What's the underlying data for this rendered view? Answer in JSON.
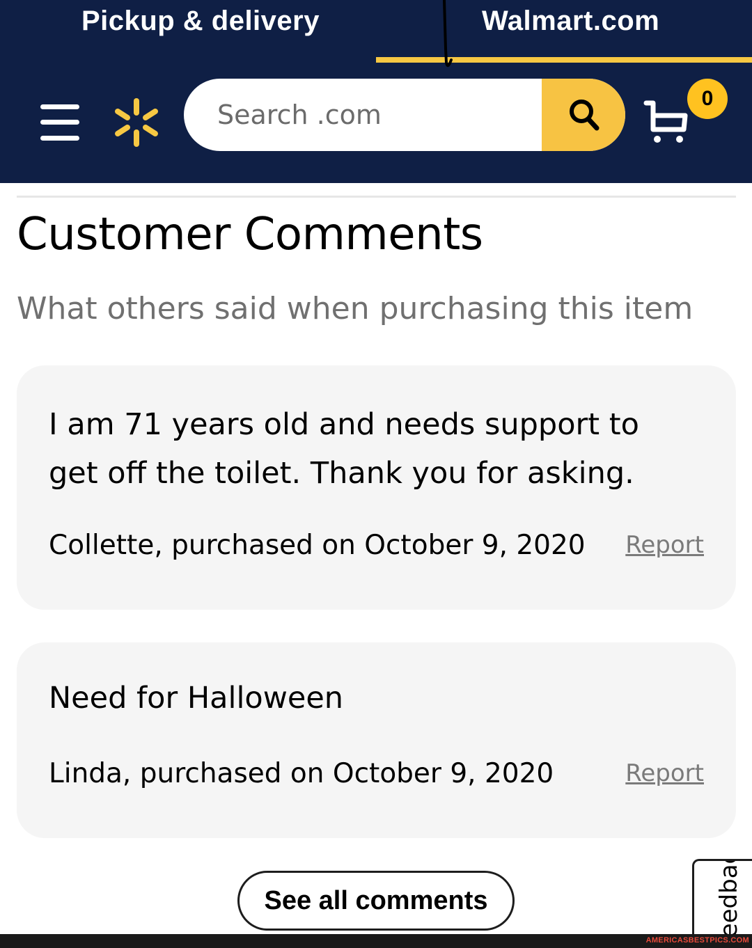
{
  "header": {
    "tabs": [
      {
        "label": "Pickup & delivery",
        "active": false
      },
      {
        "label": "Walmart.com",
        "active": true
      }
    ],
    "search": {
      "placeholder": "Search .com",
      "value": ""
    },
    "cart": {
      "count": "0"
    },
    "icons": [
      "menu-icon",
      "walmart-spark-icon",
      "search-icon",
      "cart-icon"
    ],
    "colors": {
      "background": "#0f1f45",
      "accent": "#f7c843"
    }
  },
  "main": {
    "title": "Customer Comments",
    "subtitle": "What others said when purchasing this item",
    "comments": [
      {
        "text": "I am 71 years old and needs support to get off the toilet. Thank you for asking.",
        "meta": "Collette, purchased on October 9, 2020",
        "report_label": "Report"
      },
      {
        "text": "Need for Halloween",
        "meta": "Linda, purchased on October 9, 2020",
        "report_label": "Report"
      }
    ],
    "see_all_label": "See all comments"
  },
  "feedback": {
    "label": "Feedback"
  },
  "watermark": {
    "text": "AMERICASBESTPICS.COM"
  }
}
